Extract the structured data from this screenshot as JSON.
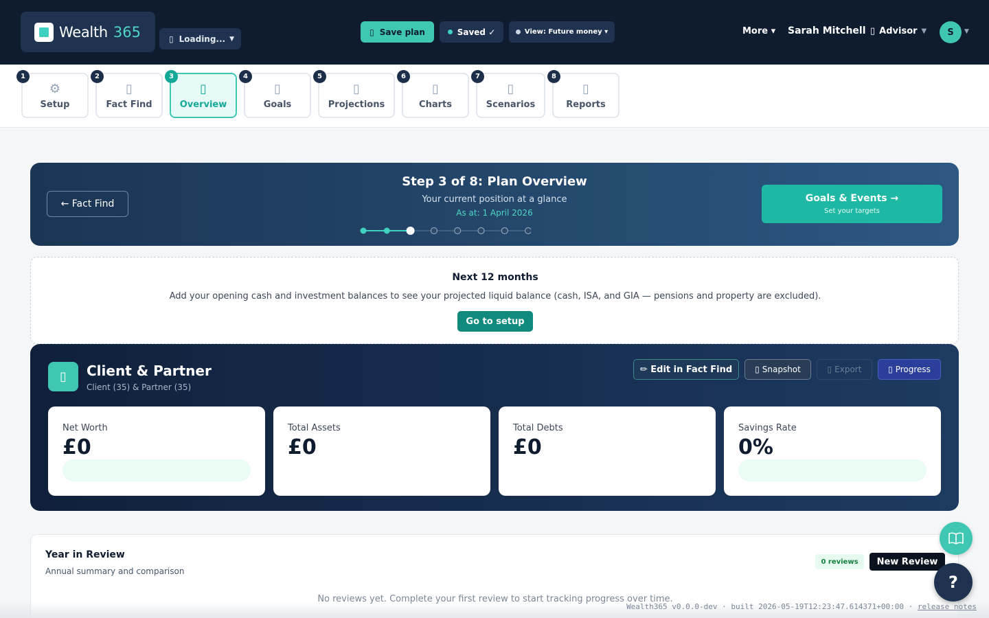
{
  "header": {
    "brand_name": "Wealth",
    "brand_num": "365",
    "loading_label": "Loading...",
    "save_label": "Save plan",
    "saved_label": "Saved ✓",
    "view_label": "View: Future money ▾",
    "more_label": "More ▾",
    "user_name": "Sarah Mitchell",
    "role_label": "Advisor",
    "avatar_initial": "S"
  },
  "tabs": [
    {
      "num": "1",
      "label": "Setup",
      "icon": "gear-icon"
    },
    {
      "num": "2",
      "label": "Fact Find",
      "icon": "clipboard-icon"
    },
    {
      "num": "3",
      "label": "Overview",
      "icon": "overview-icon",
      "active": true
    },
    {
      "num": "4",
      "label": "Goals",
      "icon": "target-icon"
    },
    {
      "num": "5",
      "label": "Projections",
      "icon": "projection-icon"
    },
    {
      "num": "6",
      "label": "Charts",
      "icon": "chart-icon"
    },
    {
      "num": "7",
      "label": "Scenarios",
      "icon": "scenario-icon"
    },
    {
      "num": "8",
      "label": "Reports",
      "icon": "report-icon"
    }
  ],
  "step": {
    "back_label": "← Fact Find",
    "title": "Step 3 of 8: Plan Overview",
    "subtitle": "Your current position at a glance",
    "as_at": "As at: 1 April 2026",
    "current": 3,
    "total": 8,
    "next_label": "Goals & Events →",
    "next_sub": "Set your targets"
  },
  "next12": {
    "title": "Next 12 months",
    "text": "Add your opening cash and investment balances to see your projected liquid balance (cash, ISA, and GIA — pensions and property are excluded).",
    "button": "Go to setup"
  },
  "client": {
    "title": "Client & Partner",
    "subtitle": "Client (35) & Partner (35)",
    "edit_label": "✏ Edit in Fact Find",
    "snapshot_label": "Snapshot",
    "export_label": "Export",
    "progress_label": "Progress",
    "stats": [
      {
        "label": "Net Worth",
        "value": "£0"
      },
      {
        "label": "Total Assets",
        "value": "£0"
      },
      {
        "label": "Total Debts",
        "value": "£0"
      },
      {
        "label": "Savings Rate",
        "value": "0%"
      }
    ]
  },
  "review": {
    "title": "Year in Review",
    "subtitle": "Annual summary and comparison",
    "badge": "0 reviews",
    "new_label": "New Review",
    "empty_text": "No reviews yet. Complete your first review to start tracking progress over time."
  },
  "fab": {
    "help_label": "?"
  },
  "footer": {
    "build": "Wealth365 v0.0.0-dev · built 2026-05-19T12:23:47.614371+00:00 · ",
    "release_notes": "release notes"
  },
  "colors": {
    "accent": "#3fc7b4",
    "header_bg": "#0f1c30",
    "primary_dark": "#0f8a7c"
  }
}
